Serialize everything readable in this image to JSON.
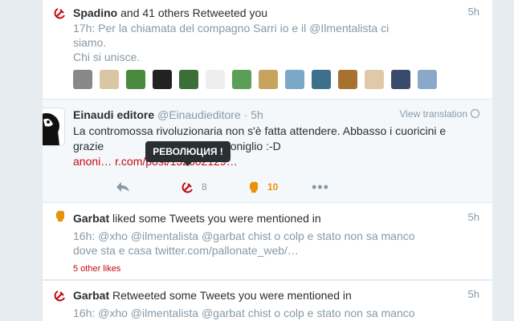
{
  "retweet_notice": {
    "actor": "Spadino",
    "action": "and 41 others Retweeted you",
    "time": "5h",
    "line1": "17h: Per la chiamata del compagno Sarri io e il @Ilmentalista ci",
    "line2": "siamo.",
    "line3": "Chi si unisce.",
    "avatars": [
      "#888888",
      "#d9c7a4",
      "#4a8a3e",
      "#222222",
      "#3c6e3a",
      "#eeeeee",
      "#5a9e58",
      "#c7a35e",
      "#7ba8c9",
      "#3b6f8c",
      "#a7712f",
      "#e0c9a8",
      "#3a4a6a",
      "#8aa9c9"
    ]
  },
  "tweet": {
    "name": "Einaudi editore",
    "handle": "@Einaudieditore · 5h",
    "view_translation": "View translation",
    "text1": "La contromossa rivoluzionaria non s'è fatta attendere. Abbasso i cuoricini e",
    "text2_a": "grazie",
    "text2_b": "imoconiglio :-D",
    "text3": "anoni…                 r.com/post/132602129…",
    "tooltip": "РЕВОЛЮЦИЯ !",
    "retweet_count": "8",
    "like_count": "10",
    "colors": {
      "red": "#c20a13",
      "orange": "#e8920c"
    }
  },
  "like_notice": {
    "actor": "Garbat",
    "action": "liked some Tweets you were mentioned in",
    "time": "5h",
    "line1": "16h: @xho @ilmentalista @garbat chist o colp e stato non sa manco",
    "line2": "dove sta e casa twitter.com/pallonate_web/…",
    "other_likes": "5 other likes"
  },
  "retweet_notice2": {
    "actor": "Garbat",
    "action": "Retweeted some Tweets you were mentioned in",
    "time": "5h",
    "line1": "16h: @xho @ilmentalista @garbat chist o colp e stato non sa manco"
  }
}
